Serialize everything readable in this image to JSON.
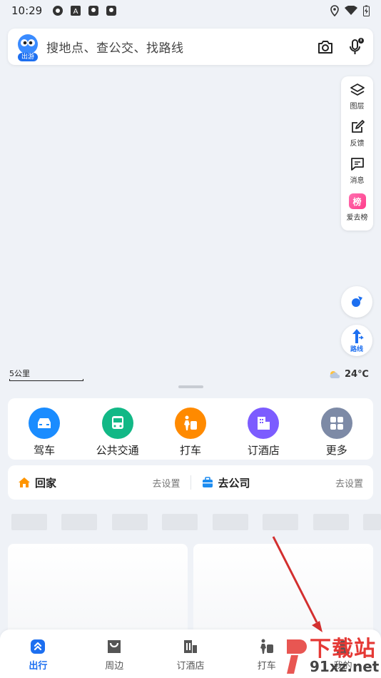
{
  "status_bar": {
    "time": "10:29"
  },
  "search": {
    "placeholder": "搜地点、查公交、找路线",
    "logo_badge": "出游"
  },
  "map_tools": [
    {
      "label": "图层",
      "icon": "layers-icon"
    },
    {
      "label": "反馈",
      "icon": "edit-icon"
    },
    {
      "label": "消息",
      "icon": "message-icon"
    },
    {
      "label": "爱去榜",
      "icon": "ranking-icon",
      "badge": "榜"
    }
  ],
  "route_button": {
    "label": "路线"
  },
  "map": {
    "scale": "5公里",
    "weather": "24℃"
  },
  "quick_actions": [
    {
      "label": "驾车",
      "icon": "car-icon",
      "color": "#1a8cff"
    },
    {
      "label": "公共交通",
      "icon": "bus-icon",
      "color": "#12b886"
    },
    {
      "label": "打车",
      "icon": "taxi-icon",
      "color": "#ff8a00"
    },
    {
      "label": "订酒店",
      "icon": "hotel-icon",
      "color": "#7c5cff"
    },
    {
      "label": "更多",
      "icon": "grid-icon",
      "color": "#7d8aa6"
    }
  ],
  "shortcuts": {
    "home": {
      "title": "回家",
      "action": "去设置"
    },
    "work": {
      "title": "去公司",
      "action": "去设置"
    }
  },
  "tabs": [
    {
      "label": "出行",
      "icon": "travel-icon",
      "active": true
    },
    {
      "label": "周边",
      "icon": "nearby-icon",
      "active": false
    },
    {
      "label": "订酒店",
      "icon": "hotel-tab-icon",
      "active": false
    },
    {
      "label": "打车",
      "icon": "taxi-tab-icon",
      "active": false
    },
    {
      "label": "我的",
      "icon": "profile-icon",
      "active": false
    }
  ],
  "watermark": {
    "text": "下载站",
    "url": "91xz.net"
  },
  "colors": {
    "accent": "#1d6ff0",
    "arrow": "#d32f2f"
  }
}
